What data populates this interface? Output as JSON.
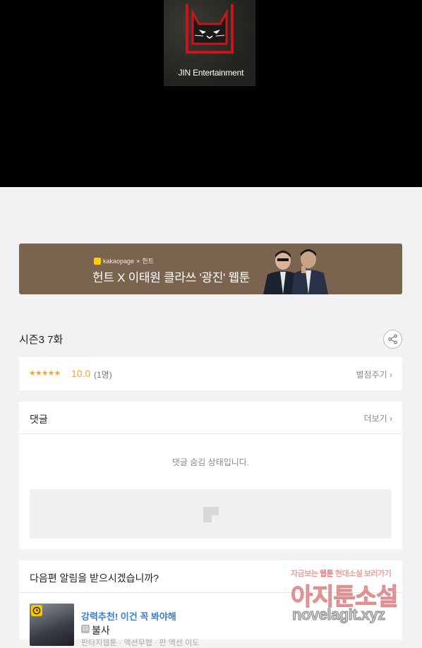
{
  "viewer": {
    "logo_text": "JIN Entertainment",
    "logo_dot": "·"
  },
  "banner": {
    "brand_small": "kakaopage",
    "brand_sep": "×",
    "brand_partner": "헌트",
    "title": "헌트 X 이태원 클라쓰 '광진' 웹툰",
    "bg_color": "#7a6450"
  },
  "episode": {
    "title": "시즌3 7화",
    "share_icon": "share-icon"
  },
  "rating": {
    "stars": "★★★★★",
    "score": "10.0",
    "count": "(1명)",
    "rate_link": "별점주기 ›",
    "star_color": "#f5a623"
  },
  "comments": {
    "heading": "댓글",
    "more": "더보기 ›",
    "hidden_message": "댓글 숨김 상태입니다."
  },
  "notify": {
    "heading": "다음편 알림을 받으시겠습니까?",
    "recommend": "강력추천! 이건 꼭 봐야해",
    "age_badge": "15",
    "title": "불사",
    "subtitle": "판타지웹툰 · 액션무협 · 판 액션 이도"
  },
  "watermark": {
    "line1_a": "자금보는",
    "line1_b": "웹툰",
    "line1_c": "현대소설",
    "line1_d": "보러가기",
    "line2": "아지툰소설",
    "line3": "novelagit.xyz"
  }
}
